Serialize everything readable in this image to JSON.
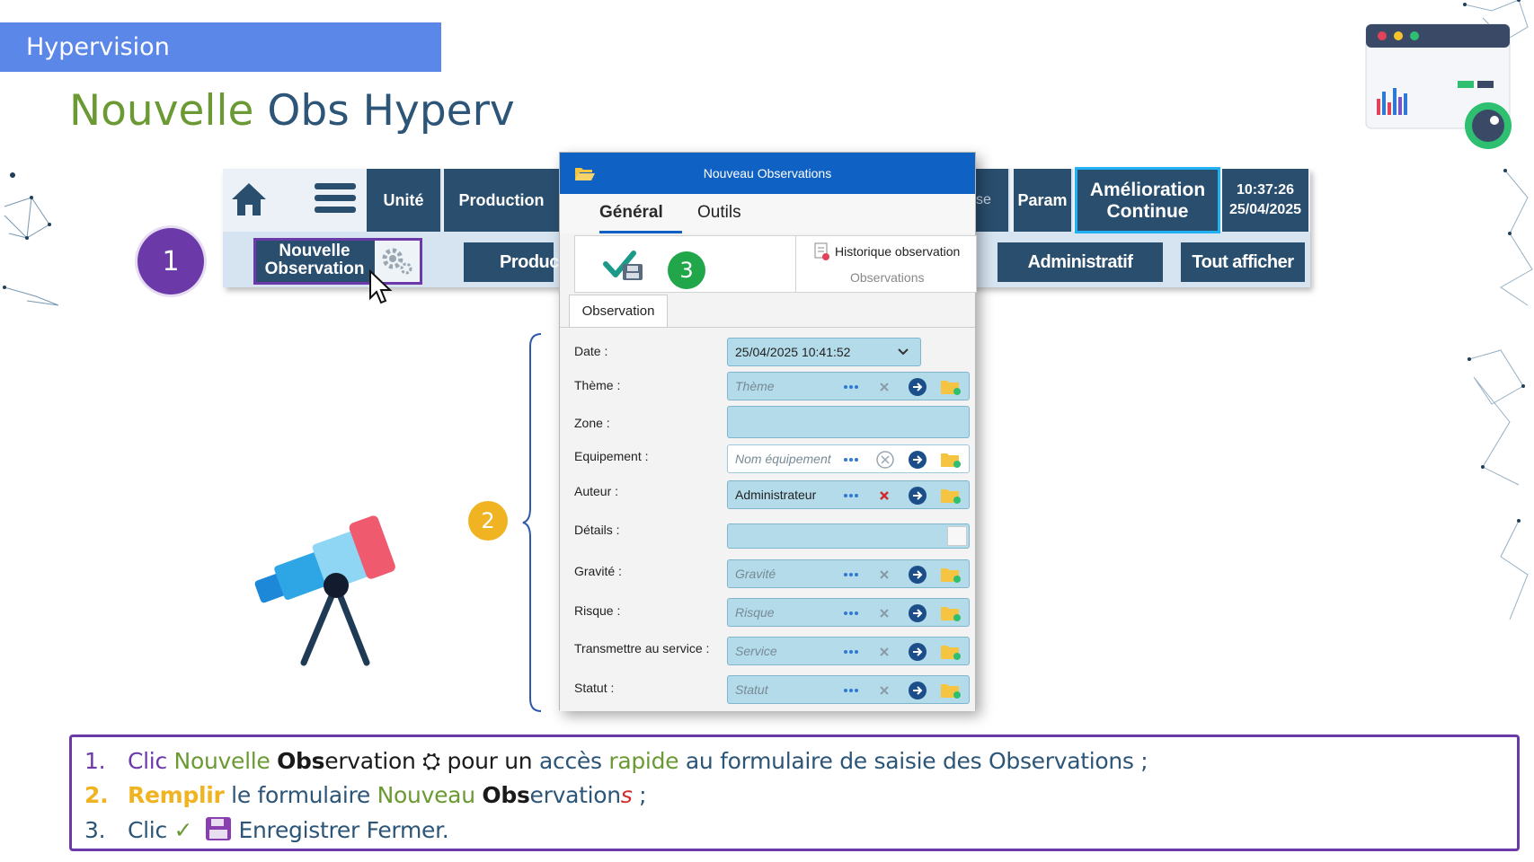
{
  "banner": {
    "title": "Hypervision"
  },
  "slide_title": {
    "part1": "Nouvelle",
    "part2": "Obs Hyperv"
  },
  "toolbar": {
    "nav": [
      "Unité",
      "Production",
      "se",
      "Param"
    ],
    "amelioration_line1": "Amélioration",
    "amelioration_line2": "Continue",
    "time": "10:37:26",
    "date": "25/04/2025",
    "nouvelle_line1": "Nouvelle",
    "nouvelle_line2": "Observation",
    "sub": [
      "Produc",
      "Administratif",
      "Tout afficher"
    ]
  },
  "badges": {
    "b1": "1",
    "b2": "2",
    "b3": "3"
  },
  "dialog": {
    "title": "Nouveau Observations",
    "tabs": [
      "Général",
      "Outils"
    ],
    "history_label": "Historique observation",
    "history_group": "Observations",
    "form_tab": "Observation",
    "fields": [
      {
        "label": "Date :",
        "value": "25/04/2025 10:41:52"
      },
      {
        "label": "Thème :",
        "placeholder": "Thème"
      },
      {
        "label": "Zone :",
        "value": ""
      },
      {
        "label": "Equipement :",
        "placeholder": "Nom équipement"
      },
      {
        "label": "Auteur :",
        "value": "Administrateur"
      },
      {
        "label": "Détails :",
        "value": ""
      },
      {
        "label": "Gravité :",
        "placeholder": "Gravité"
      },
      {
        "label": "Risque :",
        "placeholder": "Risque"
      },
      {
        "label": "Transmettre au service :",
        "placeholder": "Service"
      },
      {
        "label": "Statut :",
        "placeholder": "Statut"
      }
    ]
  },
  "instructions": {
    "line1": {
      "num": "1.",
      "t1": "Clic ",
      "t2": "Nouvelle ",
      "t3": "Obs",
      "t4": "ervation ",
      "gear": "⛭",
      "t5": " pour un ",
      "t6": "accès ",
      "t7": "rapide",
      "t8": " au formulaire de saisie des Observations ;"
    },
    "line2": {
      "num": "2.",
      "t1": "Remplir",
      "t2": " le formulaire ",
      "t3": "Nouveau ",
      "t4": "Obs",
      "t5": "ervation",
      "t6": "s",
      "t7": " ;"
    },
    "line3": {
      "num": "3.",
      "t1": "Clic ",
      "check": "✓",
      "t2": " Enregistrer Fermer."
    }
  },
  "colors": {
    "banner": "#5b87e8",
    "nav": "#2a4e6e",
    "dialog_title": "#1061c4",
    "field": "#b3dbea",
    "accent_purple": "#6b3aa8",
    "accent_green": "#6b9a34",
    "accent_orange": "#f0b321"
  }
}
